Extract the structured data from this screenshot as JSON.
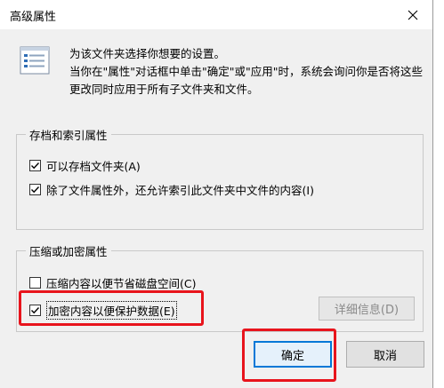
{
  "window": {
    "title": "高级属性"
  },
  "intro": {
    "line1": "为该文件夹选择你想要的设置。",
    "line2": "当你在\"属性\"对话框中单击\"确定\"或\"应用\"时，系统会询问你是否将这些",
    "line3": "更改同时应用于所有子文件夹和文件。"
  },
  "archive_group": {
    "title": "存档和索引属性",
    "archive_label": "可以存档文件夹(A)",
    "archive_checked": true,
    "index_label": "除了文件属性外，还允许索引此文件夹中文件的内容(I)",
    "index_checked": true
  },
  "compress_group": {
    "title": "压缩或加密属性",
    "compress_label": "压缩内容以便节省磁盘空间(C)",
    "compress_checked": false,
    "encrypt_label": "加密内容以便保护数据(E)",
    "encrypt_checked": true,
    "details_label": "详细信息(D)"
  },
  "buttons": {
    "ok_label": "确定",
    "cancel_label": "取消"
  },
  "colors": {
    "accent": "#0078d7",
    "annotation": "#e8141c"
  }
}
